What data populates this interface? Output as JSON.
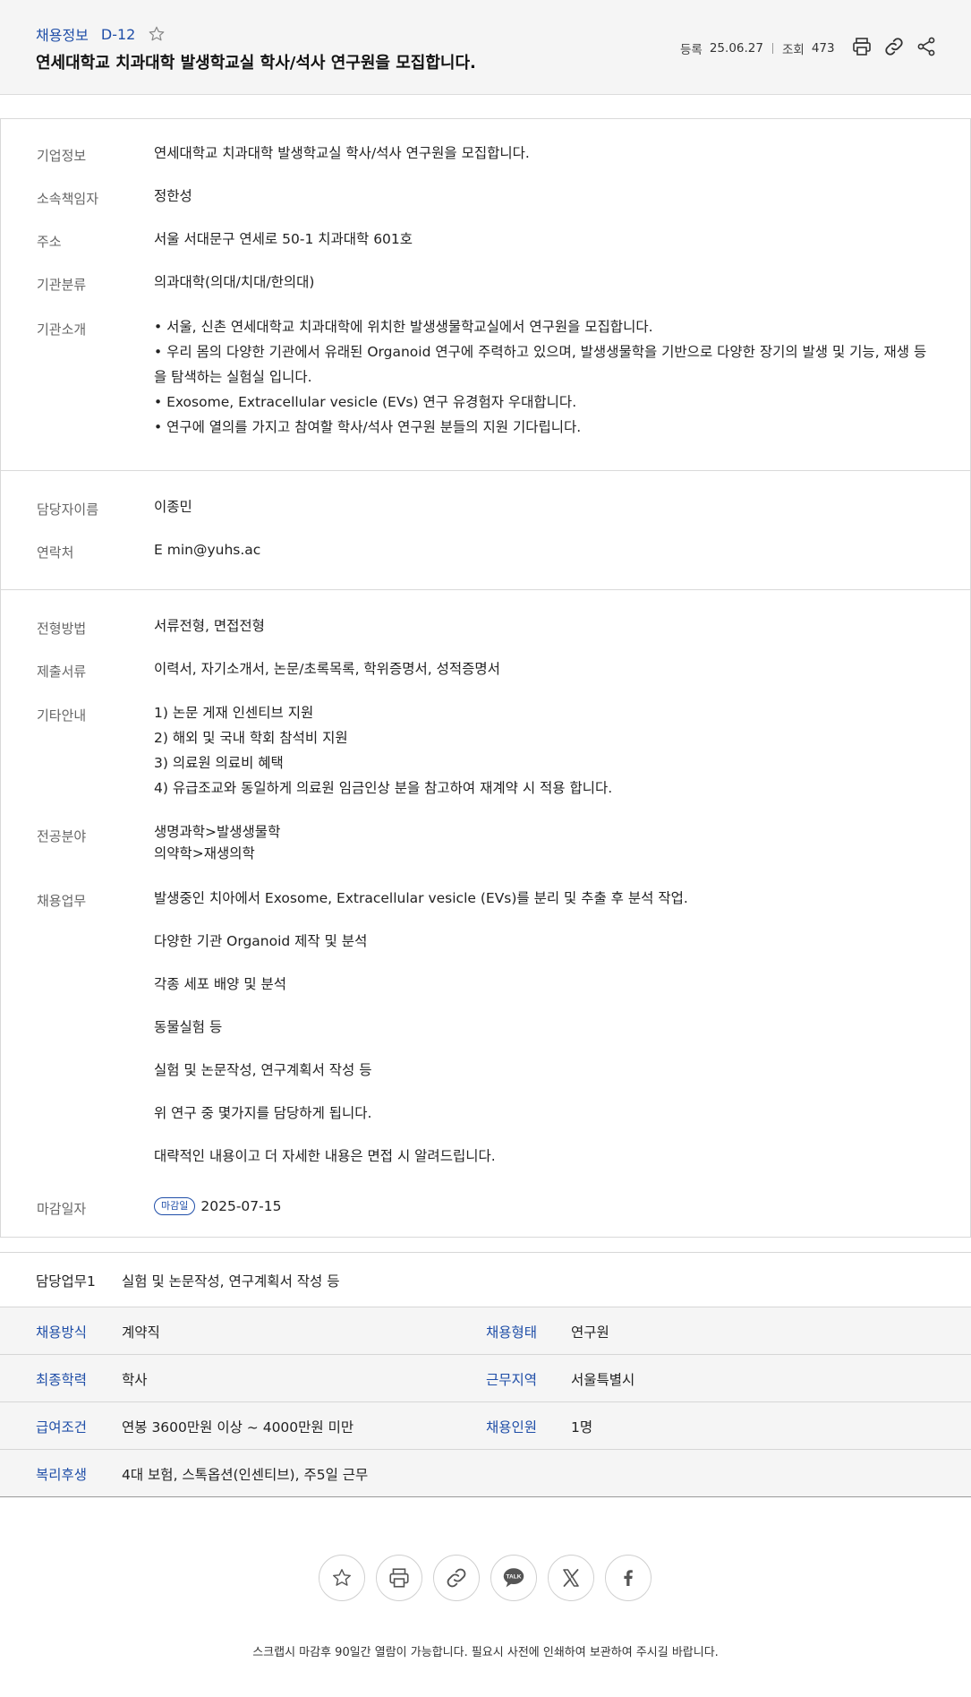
{
  "header": {
    "category": "채용정보",
    "dday": "D-12",
    "title": "연세대학교 치과대학 발생학교실 학사/석사 연구원을 모집합니다.",
    "reg_label": "등록",
    "reg_date": "25.06.27",
    "view_label": "조회",
    "view_count": "473"
  },
  "info1": [
    {
      "key": "기업정보",
      "value": "연세대학교 치과대학 발생학교실 학사/석사 연구원을 모집합니다."
    },
    {
      "key": "소속책임자",
      "value": "정한성"
    },
    {
      "key": "주소",
      "value": "서울 서대문구 연세로 50-1 치과대학 601호"
    },
    {
      "key": "기관분류",
      "value": "의과대학(의대/치대/한의대)"
    }
  ],
  "intro": {
    "key": "기관소개",
    "lines": [
      "• 서울, 신촌 연세대학교 치과대학에 위치한 발생생물학교실에서 연구원을 모집합니다.",
      "• 우리 몸의 다양한 기관에서 유래된 Organoid 연구에 주력하고 있으며, 발생생물학을 기반으로 다양한 장기의 발생 및 기능, 재생 등을 탐색하는 실험실 입니다.",
      "• Exosome, Extracellular vesicle (EVs) 연구 유경험자 우대합니다.",
      "• 연구에 열의를 가지고 참여할 학사/석사 연구원 분들의 지원 기다립니다."
    ]
  },
  "contact": [
    {
      "key": "담당자이름",
      "value": "이종민"
    },
    {
      "key": "연락처",
      "value": "E  min@yuhs.ac"
    }
  ],
  "process": [
    {
      "key": "전형방법",
      "value": "서류전형, 면접전형"
    },
    {
      "key": "제출서류",
      "value": "이력서, 자기소개서, 논문/초록목록, 학위증명서, 성적증명서"
    }
  ],
  "etc": {
    "key": "기타안내",
    "lines": [
      "1) 논문 게재 인센티브 지원",
      "2) 해외 및 국내 학회 참석비 지원",
      "3) 의료원 의료비 혜택",
      "4) 유급조교와 동일하게 의료원 임금인상 분을 참고하여 재계약 시 적용 합니다."
    ]
  },
  "major": {
    "key": "전공분야",
    "lines": [
      "생명과학>발생생물학",
      "의약학>재생의학"
    ]
  },
  "duty": {
    "key": "채용업무",
    "lines": [
      "발생중인 치아에서 Exosome, Extracellular vesicle (EVs)를 분리 및 추출 후 분석 작업.",
      "다양한 기관 Organoid 제작 및 분석",
      "각종 세포 배양 및 분석",
      "동물실험 등",
      "실험 및 논문작성, 연구계획서 작성 등",
      "위 연구 중 몇가지를 담당하게 됩니다.",
      "대략적인 내용이고 더 자세한 내용은 면접 시 알려드립니다."
    ]
  },
  "deadline": {
    "key": "마감일자",
    "badge": "마감일",
    "date": "2025-07-15"
  },
  "summary": {
    "duty1_key": "담당업무1",
    "duty1_value": "실험 및 논문작성, 연구계획서 작성 등",
    "rows": [
      {
        "k1": "채용방식",
        "v1": "계약직",
        "k2": "채용형태",
        "v2": "연구원"
      },
      {
        "k1": "최종학력",
        "v1": "학사",
        "k2": "근무지역",
        "v2": "서울특별시"
      },
      {
        "k1": "급여조건",
        "v1": "연봉 3600만원 이상 ~ 4000만원 미만",
        "k2": "채용인원",
        "v2": "1명"
      },
      {
        "k1": "복리후생",
        "v1": "4대 보험, 스톡옵션(인센티브), 주5일 근무",
        "k2": "",
        "v2": ""
      }
    ]
  },
  "notice": "스크랩시 마감후 90일간 열람이 가능합니다. 필요시 사전에 인쇄하여 보관하여 주시길 바랍니다.",
  "icons": [
    "star-icon",
    "print-icon",
    "link-icon",
    "share-icon",
    "kakaotalk-icon",
    "x-icon",
    "facebook-icon"
  ],
  "colors": {
    "accent": "#1f4ea8",
    "header_bg": "#f5f5f5",
    "border": "#d9d9d9"
  }
}
